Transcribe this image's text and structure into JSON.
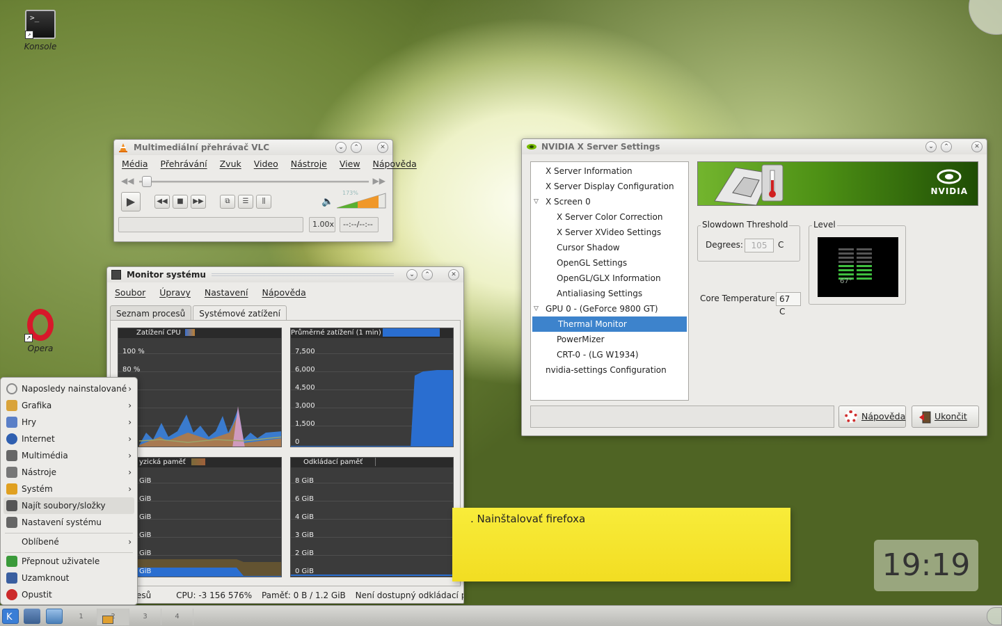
{
  "desktop": {
    "icons": [
      {
        "label": "Konsole",
        "glyph": ">_"
      },
      {
        "label": "Opera"
      }
    ]
  },
  "vlc": {
    "title": "Multimediální přehrávač VLC",
    "menus": [
      "Média",
      "Přehrávání",
      "Zvuk",
      "Video",
      "Nástroje",
      "View",
      "Nápověda"
    ],
    "volume_label": "173%",
    "speed": "1.00x",
    "time": "--:--/--:--"
  },
  "sysmon": {
    "title": "Monitor systému",
    "menus": [
      "Soubor",
      "Úpravy",
      "Nastavení",
      "Nápověda"
    ],
    "tabs": [
      "Seznam procesů",
      "Systémové zatížení"
    ],
    "active_tab": 1,
    "plots": {
      "cpu": {
        "title": "Zatížení CPU",
        "ticks": [
          "100 %",
          "80 %"
        ]
      },
      "load": {
        "title": "Průměrné zatížení (1 min)",
        "ticks": [
          "7,500",
          "6,000",
          "4,500",
          "3,000",
          "1,500",
          "0"
        ]
      },
      "mem": {
        "title": "yzická paměť",
        "ticks": [
          "GiB",
          "GiB",
          "GiB",
          "GiB",
          "GiB",
          "GiB"
        ]
      },
      "swap": {
        "title": "Odkládací paměť",
        "ticks": [
          "8 GiB",
          "6 GiB",
          "4 GiB",
          "3 GiB",
          "2 GiB",
          "0 GiB"
        ]
      }
    },
    "status": {
      "procs": "esů",
      "cpu": "CPU: -3 156 576%",
      "memory": "Paměť: 0 B / 1.2 GiB",
      "swap": "Není dostupný odkládací prostor"
    }
  },
  "nvidia": {
    "title": "NVIDIA X Server Settings",
    "tree": [
      {
        "label": "X Server Information",
        "level": 0
      },
      {
        "label": "X Server Display Configuration",
        "level": 0
      },
      {
        "label": "X Screen 0",
        "level": 0,
        "expanded": true
      },
      {
        "label": "X Server Color Correction",
        "level": 1
      },
      {
        "label": "X Server XVideo Settings",
        "level": 1
      },
      {
        "label": "Cursor Shadow",
        "level": 1
      },
      {
        "label": "OpenGL Settings",
        "level": 1
      },
      {
        "label": "OpenGL/GLX Information",
        "level": 1
      },
      {
        "label": "Antialiasing Settings",
        "level": 1
      },
      {
        "label": "GPU 0 - (GeForce 9800 GT)",
        "level": 0,
        "expanded": true
      },
      {
        "label": "Thermal Monitor",
        "level": 1,
        "selected": true
      },
      {
        "label": "PowerMizer",
        "level": 1
      },
      {
        "label": "CRT-0 - (LG W1934)",
        "level": 1
      },
      {
        "label": "nvidia-settings Configuration",
        "level": 0
      }
    ],
    "banner_brand": "NVIDIA",
    "slowdown": {
      "title": "Slowdown Threshold",
      "degrees_label": "Degrees:",
      "degrees_value": "105",
      "unit": "C"
    },
    "level": {
      "title": "Level",
      "value": "67°",
      "fraction": 0.5
    },
    "core_temp": {
      "label": "Core Temperature:",
      "value": "67 C"
    },
    "buttons": {
      "help": "Nápověda",
      "quit": "Ukončit"
    }
  },
  "note": {
    "text": ". Nainštalovať firefoxa"
  },
  "clock": {
    "time": "19:19"
  },
  "kmenu": {
    "items": [
      {
        "label": "Naposledy nainstalované",
        "submenu": true,
        "icon": "recent-icon",
        "color": "#8a8a8a"
      },
      {
        "label": "Grafika",
        "submenu": true,
        "icon": "graphics-icon",
        "color": "#d9a33a"
      },
      {
        "label": "Hry",
        "submenu": true,
        "icon": "games-icon",
        "color": "#5a7fc7"
      },
      {
        "label": "Internet",
        "submenu": true,
        "icon": "internet-icon",
        "color": "#2f5fb0"
      },
      {
        "label": "Multimédia",
        "submenu": true,
        "icon": "multimedia-icon",
        "color": "#666666"
      },
      {
        "label": "Nástroje",
        "submenu": true,
        "icon": "tools-icon",
        "color": "#777777"
      },
      {
        "label": "Systém",
        "submenu": true,
        "icon": "system-icon",
        "color": "#e0a020"
      },
      {
        "label": "Najít soubory/složky",
        "submenu": false,
        "icon": "find-files-icon",
        "color": "#555555",
        "highlight": true
      },
      {
        "label": "Nastavení systému",
        "submenu": false,
        "icon": "system-settings-icon",
        "color": "#666666"
      },
      {
        "label": "Oblíbené",
        "submenu": true,
        "icon": "favorites-icon",
        "color": ""
      },
      {
        "label": "Přepnout uživatele",
        "submenu": false,
        "icon": "switch-user-icon",
        "color": "#3a9a3a"
      },
      {
        "label": "Uzamknout",
        "submenu": false,
        "icon": "lock-icon",
        "color": "#3a5fa0"
      },
      {
        "label": "Opustit",
        "submenu": false,
        "icon": "logout-icon",
        "color": "#cc2a2a"
      }
    ]
  },
  "taskbar": {
    "pager": [
      "1",
      "2",
      "3",
      "4"
    ]
  }
}
